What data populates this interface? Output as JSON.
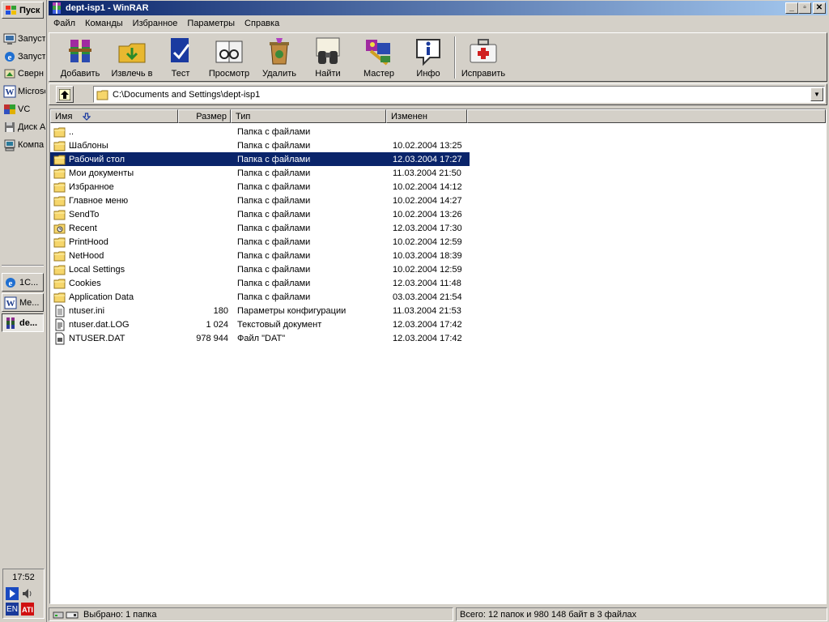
{
  "taskbar": {
    "start_label": "Пуск",
    "quick_launch": [
      {
        "label": "Запуст",
        "icon": "desktop-icon"
      },
      {
        "label": "Запуст",
        "icon": "internet-explorer-icon"
      },
      {
        "label": "Сверн",
        "icon": "show-desktop-icon"
      },
      {
        "label": "Microsof",
        "icon": "word-icon"
      },
      {
        "label": "VC",
        "icon": "visual-c-icon"
      },
      {
        "label": "Диск А",
        "icon": "floppy-icon"
      },
      {
        "label": "Компа",
        "icon": "my-computer-icon"
      }
    ],
    "tasks": [
      {
        "label": "1C...",
        "icon": "internet-explorer-icon"
      },
      {
        "label": "Me...",
        "icon": "word-icon"
      },
      {
        "label": "de...",
        "icon": "winrar-icon"
      }
    ],
    "clock": "17:52",
    "tray_lang": "EN"
  },
  "window": {
    "title": "dept-isp1 - WinRAR",
    "menu": [
      "Файл",
      "Команды",
      "Избранное",
      "Параметры",
      "Справка"
    ],
    "toolbar": [
      {
        "label": "Добавить",
        "icon": "add-archive-icon"
      },
      {
        "label": "Извлечь в",
        "icon": "extract-icon"
      },
      {
        "label": "Тест",
        "icon": "test-icon"
      },
      {
        "label": "Просмотр",
        "icon": "view-icon"
      },
      {
        "label": "Удалить",
        "icon": "delete-icon"
      },
      {
        "label": "Найти",
        "icon": "find-icon"
      },
      {
        "label": "Мастер",
        "icon": "wizard-icon"
      },
      {
        "label": "Инфо",
        "icon": "info-icon"
      },
      {
        "label": "Исправить",
        "icon": "repair-icon"
      }
    ],
    "address": "C:\\Documents and Settings\\dept-isp1",
    "columns": [
      "Имя",
      "Размер",
      "Тип",
      "Изменен"
    ],
    "files": [
      {
        "name": "..",
        "size": "",
        "type": "Папка с файлами",
        "modified": "",
        "icon": "folder-icon"
      },
      {
        "name": "Шаблоны",
        "size": "",
        "type": "Папка с файлами",
        "modified": "10.02.2004 13:25",
        "icon": "folder-icon"
      },
      {
        "name": "Рабочий стол",
        "size": "",
        "type": "Папка с файлами",
        "modified": "12.03.2004 17:27",
        "icon": "folder-icon",
        "selected": true
      },
      {
        "name": "Мои документы",
        "size": "",
        "type": "Папка с файлами",
        "modified": "11.03.2004 21:50",
        "icon": "folder-icon"
      },
      {
        "name": "Избранное",
        "size": "",
        "type": "Папка с файлами",
        "modified": "10.02.2004 14:12",
        "icon": "folder-icon"
      },
      {
        "name": "Главное меню",
        "size": "",
        "type": "Папка с файлами",
        "modified": "10.02.2004 14:27",
        "icon": "folder-icon"
      },
      {
        "name": "SendTo",
        "size": "",
        "type": "Папка с файлами",
        "modified": "10.02.2004 13:26",
        "icon": "folder-icon"
      },
      {
        "name": "Recent",
        "size": "",
        "type": "Папка с файлами",
        "modified": "12.03.2004 17:30",
        "icon": "recent-folder-icon"
      },
      {
        "name": "PrintHood",
        "size": "",
        "type": "Папка с файлами",
        "modified": "10.02.2004 12:59",
        "icon": "folder-icon"
      },
      {
        "name": "NetHood",
        "size": "",
        "type": "Папка с файлами",
        "modified": "10.03.2004 18:39",
        "icon": "folder-icon"
      },
      {
        "name": "Local Settings",
        "size": "",
        "type": "Папка с файлами",
        "modified": "10.02.2004 12:59",
        "icon": "folder-icon"
      },
      {
        "name": "Cookies",
        "size": "",
        "type": "Папка с файлами",
        "modified": "12.03.2004 11:48",
        "icon": "folder-icon"
      },
      {
        "name": "Application Data",
        "size": "",
        "type": "Папка с файлами",
        "modified": "03.03.2004 21:54",
        "icon": "folder-icon"
      },
      {
        "name": "ntuser.ini",
        "size": "180",
        "type": "Параметры конфигурации",
        "modified": "11.03.2004 21:53",
        "icon": "ini-file-icon"
      },
      {
        "name": "ntuser.dat.LOG",
        "size": "1 024",
        "type": "Текстовый документ",
        "modified": "12.03.2004 17:42",
        "icon": "text-file-icon"
      },
      {
        "name": "NTUSER.DAT",
        "size": "978 944",
        "type": "Файл \"DAT\"",
        "modified": "12.03.2004 17:42",
        "icon": "dat-file-icon"
      }
    ],
    "status_left": "Выбрано: 1 папка",
    "status_right": "Всего: 12 папок и 980 148 байт в 3 файлах"
  },
  "colors": {
    "title_active": "#0a246a",
    "selection": "#0a246a",
    "face": "#d4d0c8",
    "folder": "#f6d66b"
  }
}
